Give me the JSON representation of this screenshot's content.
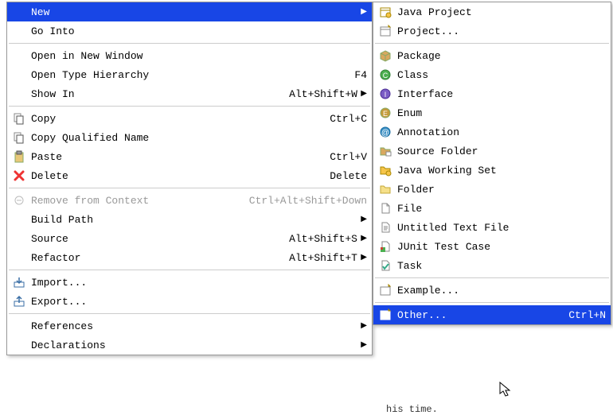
{
  "leftMenu": {
    "items": [
      {
        "label": "New",
        "shortcut": "",
        "hasArrow": true,
        "selected": true,
        "icon": null
      },
      {
        "label": "Go Into",
        "shortcut": "",
        "hasArrow": false,
        "icon": null
      },
      {
        "sep": true
      },
      {
        "label": "Open in New Window",
        "shortcut": "",
        "hasArrow": false,
        "icon": null
      },
      {
        "label": "Open Type Hierarchy",
        "shortcut": "F4",
        "hasArrow": false,
        "icon": null
      },
      {
        "label": "Show In",
        "shortcut": "Alt+Shift+W",
        "hasArrow": true,
        "icon": null
      },
      {
        "sep": true
      },
      {
        "label": "Copy",
        "shortcut": "Ctrl+C",
        "hasArrow": false,
        "icon": "copy"
      },
      {
        "label": "Copy Qualified Name",
        "shortcut": "",
        "hasArrow": false,
        "icon": "copy"
      },
      {
        "label": "Paste",
        "shortcut": "Ctrl+V",
        "hasArrow": false,
        "icon": "paste"
      },
      {
        "label": "Delete",
        "shortcut": "Delete",
        "hasArrow": false,
        "icon": "delete"
      },
      {
        "sep": true
      },
      {
        "label": "Remove from Context",
        "shortcut": "Ctrl+Alt+Shift+Down",
        "hasArrow": false,
        "icon": "remove-context",
        "disabled": true
      },
      {
        "label": "Build Path",
        "shortcut": "",
        "hasArrow": true,
        "icon": null
      },
      {
        "label": "Source",
        "shortcut": "Alt+Shift+S",
        "hasArrow": true,
        "icon": null
      },
      {
        "label": "Refactor",
        "shortcut": "Alt+Shift+T",
        "hasArrow": true,
        "icon": null
      },
      {
        "sep": true
      },
      {
        "label": "Import...",
        "shortcut": "",
        "hasArrow": false,
        "icon": "import"
      },
      {
        "label": "Export...",
        "shortcut": "",
        "hasArrow": false,
        "icon": "export"
      },
      {
        "sep": true
      },
      {
        "label": "References",
        "shortcut": "",
        "hasArrow": true,
        "icon": null
      },
      {
        "label": "Declarations",
        "shortcut": "",
        "hasArrow": true,
        "icon": null
      }
    ]
  },
  "rightMenu": {
    "items": [
      {
        "label": "Java Project",
        "icon": "java-project"
      },
      {
        "label": "Project...",
        "icon": "project"
      },
      {
        "sep": true
      },
      {
        "label": "Package",
        "icon": "package"
      },
      {
        "label": "Class",
        "icon": "class"
      },
      {
        "label": "Interface",
        "icon": "interface"
      },
      {
        "label": "Enum",
        "icon": "enum"
      },
      {
        "label": "Annotation",
        "icon": "annotation"
      },
      {
        "label": "Source Folder",
        "icon": "source-folder"
      },
      {
        "label": "Java Working Set",
        "icon": "working-set"
      },
      {
        "label": "Folder",
        "icon": "folder"
      },
      {
        "label": "File",
        "icon": "file"
      },
      {
        "label": "Untitled Text File",
        "icon": "text-file"
      },
      {
        "label": "JUnit Test Case",
        "icon": "junit"
      },
      {
        "label": "Task",
        "icon": "task"
      },
      {
        "sep": true
      },
      {
        "label": "Example...",
        "icon": "example"
      },
      {
        "sep": true
      },
      {
        "label": "Other...",
        "shortcut": "Ctrl+N",
        "icon": "other",
        "selected": true
      }
    ]
  },
  "statusText": "his time."
}
